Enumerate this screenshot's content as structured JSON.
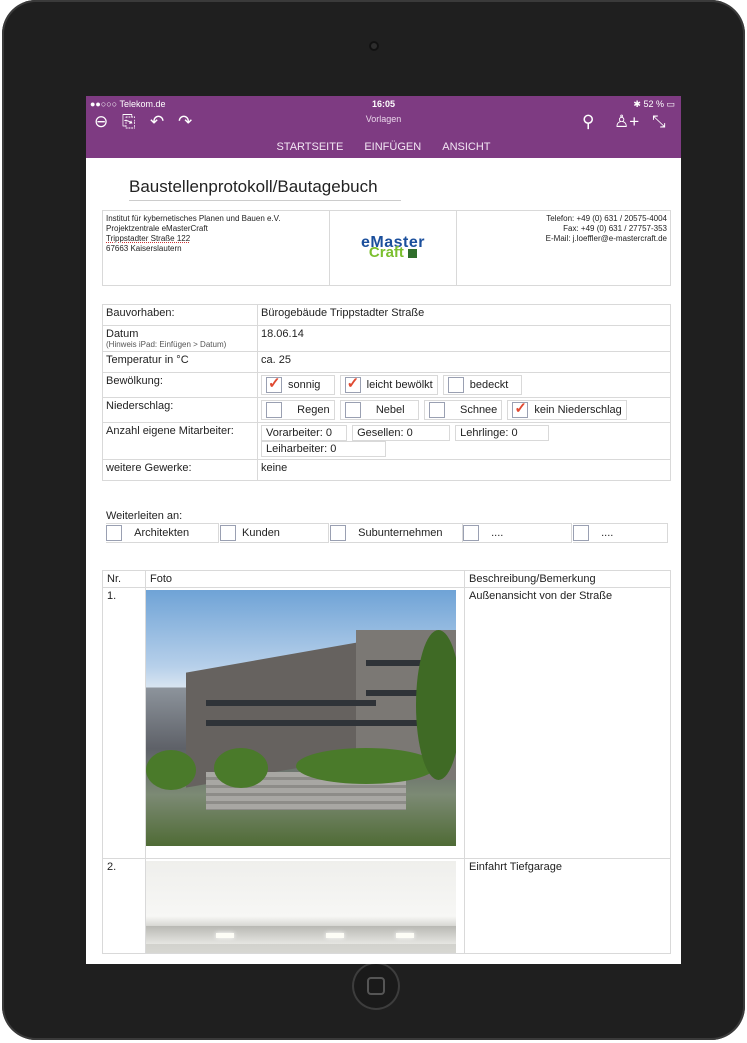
{
  "status": {
    "carrier": "●●○○○ Telekom.de",
    "time": "16:05",
    "battery": "52 %"
  },
  "app": {
    "doc_title": "Vorlagen",
    "tabs": [
      "STARTSEITE",
      "EINFÜGEN",
      "ANSICHT"
    ]
  },
  "document": {
    "heading": "Baustellenprotokoll/Bautagebuch",
    "header": {
      "address": [
        "Institut für kybernetisches Planen und Bauen e.V.",
        "Projektzentrale eMasterCraft",
        "Trippstadter Straße 122",
        "67663 Kaiserslautern"
      ],
      "logo_line1": "eMaster",
      "logo_line2": "Craft",
      "contact": [
        "Telefon: +49 (0) 631 / 20575-4004",
        "Fax: +49 (0) 631 / 27757-353",
        "E-Mail: j.loeffler@e-mastercraft.de"
      ]
    },
    "info": {
      "bauvorhaben_label": "Bauvorhaben:",
      "bauvorhaben_value": "Bürogebäude Trippstadter Straße",
      "datum_label": "Datum",
      "datum_hint": "(Hinweis iPad: Einfügen > Datum)",
      "datum_value": "18.06.14",
      "temp_label": "Temperatur in °C",
      "temp_value": "ca. 25",
      "bewoelkung_label": "Bewölkung:",
      "bewoelkung_opts": [
        {
          "label": "sonnig",
          "checked": true
        },
        {
          "label": "leicht bewölkt",
          "checked": true
        },
        {
          "label": "bedeckt",
          "checked": false
        }
      ],
      "niederschlag_label": "Niederschlag:",
      "niederschlag_opts": [
        {
          "label": "Regen",
          "checked": false
        },
        {
          "label": "Nebel",
          "checked": false
        },
        {
          "label": "Schnee",
          "checked": false
        },
        {
          "label": "kein Niederschlag",
          "checked": true
        }
      ],
      "mitarbeiter_label": "Anzahl eigene Mitarbeiter:",
      "mitarbeiter": [
        "Vorarbeiter:  0",
        "Gesellen: 0",
        "Lehrlinge: 0",
        "Leiharbeiter: 0"
      ],
      "gewerke_label": "weitere Gewerke:",
      "gewerke_value": "keine"
    },
    "forward": {
      "title": "Weiterleiten an:",
      "options": [
        "Architekten",
        "Kunden",
        "Subunternehmen",
        "....",
        "...."
      ]
    },
    "photos": {
      "headers": [
        "Nr.",
        "Foto",
        "Beschreibung/Bemerkung"
      ],
      "rows": [
        {
          "nr": "1.",
          "desc": "Außenansicht von der Straße"
        },
        {
          "nr": "2.",
          "desc": "Einfahrt Tiefgarage"
        }
      ]
    }
  }
}
